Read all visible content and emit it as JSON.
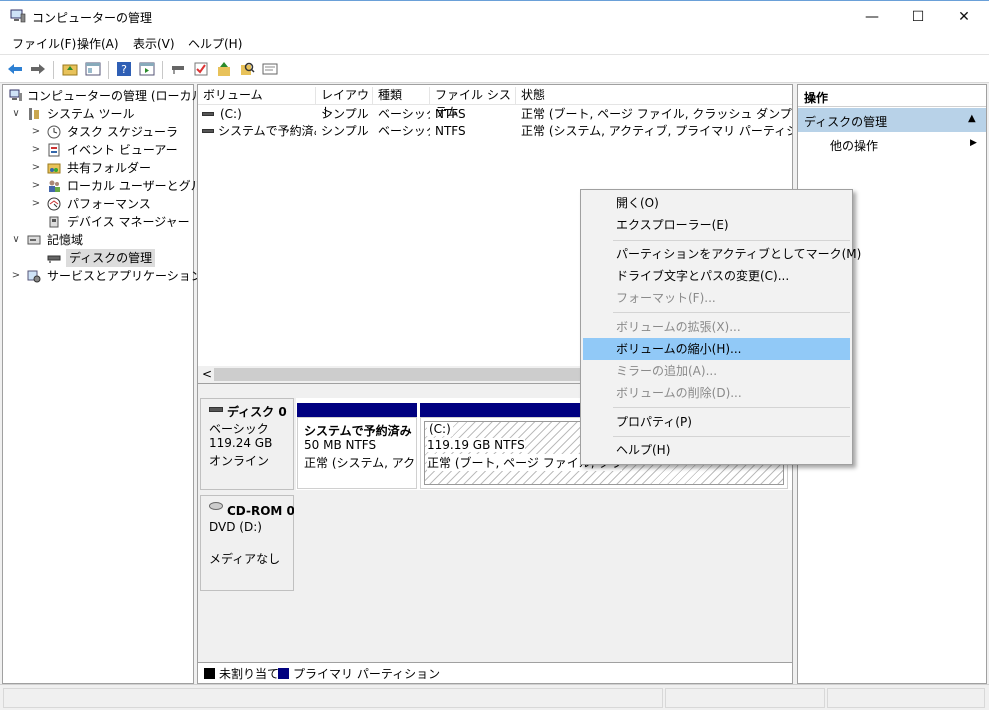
{
  "window": {
    "title": "コンピューターの管理",
    "controls": {
      "minimize": "—",
      "maximize": "☐",
      "close": "✕"
    }
  },
  "menubar": [
    "ファイル(F)",
    "操作(A)",
    "表示(V)",
    "ヘルプ(H)"
  ],
  "toolbar": [
    "back-icon",
    "forward-icon",
    "up-folder-icon",
    "show-hide-tree-icon",
    "help-icon",
    "console-view-icon",
    "connect-icon",
    "check-icon",
    "export-icon",
    "search-icon",
    "properties-icon"
  ],
  "tree": {
    "items": [
      {
        "label": "コンピューターの管理 (ローカル)",
        "expander": "",
        "icon": "computer-management-icon"
      },
      {
        "label": "システム ツール",
        "expander": "∨",
        "icon": "system-tools-icon"
      },
      {
        "label": "タスク スケジューラ",
        "expander": ">",
        "icon": "clock-icon"
      },
      {
        "label": "イベント ビューアー",
        "expander": ">",
        "icon": "event-viewer-icon"
      },
      {
        "label": "共有フォルダー",
        "expander": ">",
        "icon": "shared-folder-icon"
      },
      {
        "label": "ローカル ユーザーとグループ",
        "expander": ">",
        "icon": "users-icon"
      },
      {
        "label": "パフォーマンス",
        "expander": ">",
        "icon": "performance-icon"
      },
      {
        "label": "デバイス マネージャー",
        "expander": "",
        "icon": "device-manager-icon"
      },
      {
        "label": "記憶域",
        "expander": "∨",
        "icon": "storage-icon"
      },
      {
        "label": "ディスクの管理",
        "expander": "",
        "icon": "disk-management-icon"
      },
      {
        "label": "サービスとアプリケーション",
        "expander": ">",
        "icon": "services-icon"
      }
    ]
  },
  "volume_list": {
    "columns": [
      "ボリューム",
      "レイアウト",
      "種類",
      "ファイル システム",
      "状態"
    ],
    "rows": [
      [
        "(C:)",
        "シンプル",
        "ベーシック",
        "NTFS",
        "正常 (ブート, ページ ファイル, クラッシュ ダンプ, プライマリ パー"
      ],
      [
        "システムで予約済み",
        "シンプル",
        "ベーシック",
        "NTFS",
        "正常 (システム, アクティブ, プライマリ パーティション)"
      ]
    ],
    "scroll_left": "<"
  },
  "disks": {
    "disk0": {
      "name": "ディスク 0",
      "type": "ベーシック",
      "size": "119.24 GB",
      "status": "オンライン",
      "partitions": [
        {
          "name": "システムで予約済み",
          "size": "50 MB NTFS",
          "status": "正常 (システム, アクティ"
        },
        {
          "name": "(C:)",
          "size": "119.19 GB NTFS",
          "status": "正常 (ブート, ページ ファイル, クラ"
        }
      ]
    },
    "cdrom0": {
      "name": "CD-ROM 0",
      "type": "DVD (D:)",
      "status": "メディアなし"
    }
  },
  "legend": [
    {
      "label": "未割り当て",
      "color": "#000000"
    },
    {
      "label": "プライマリ パーティション",
      "color": "#000080"
    }
  ],
  "actions": {
    "header": "操作",
    "section": "ディスクの管理",
    "item": "他の操作",
    "section_arrow": "▲",
    "item_arrow": "▶"
  },
  "context_menu": {
    "items": [
      {
        "label": "開く(O)",
        "enabled": true
      },
      {
        "label": "エクスプローラー(E)",
        "enabled": true
      },
      {
        "label": "パーティションをアクティブとしてマーク(M)",
        "enabled": true
      },
      {
        "label": "ドライブ文字とパスの変更(C)...",
        "enabled": true
      },
      {
        "label": "フォーマット(F)...",
        "enabled": false
      },
      {
        "label": "ボリュームの拡張(X)...",
        "enabled": false
      },
      {
        "label": "ボリュームの縮小(H)...",
        "enabled": true,
        "highlighted": true
      },
      {
        "label": "ミラーの追加(A)...",
        "enabled": false
      },
      {
        "label": "ボリュームの削除(D)...",
        "enabled": false
      },
      {
        "label": "プロパティ(P)",
        "enabled": true
      },
      {
        "label": "ヘルプ(H)",
        "enabled": true
      }
    ]
  },
  "colors": {
    "partition_header": "#000080",
    "menu_highlight": "#91c9f7",
    "actions_section": "#b8d2e8"
  }
}
